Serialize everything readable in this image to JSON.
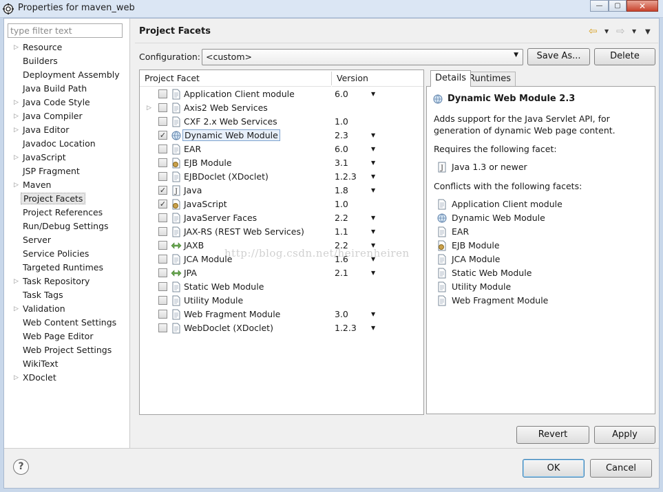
{
  "window": {
    "title": "Properties for maven_web",
    "minimize": "—",
    "maximize": "▢",
    "close": "✕"
  },
  "filter": {
    "placeholder": "type filter text",
    "value": ""
  },
  "nav": {
    "items": [
      {
        "label": "Resource",
        "expandable": true
      },
      {
        "label": "Builders",
        "expandable": false
      },
      {
        "label": "Deployment Assembly",
        "expandable": false
      },
      {
        "label": "Java Build Path",
        "expandable": false
      },
      {
        "label": "Java Code Style",
        "expandable": true
      },
      {
        "label": "Java Compiler",
        "expandable": true
      },
      {
        "label": "Java Editor",
        "expandable": true
      },
      {
        "label": "Javadoc Location",
        "expandable": false
      },
      {
        "label": "JavaScript",
        "expandable": true
      },
      {
        "label": "JSP Fragment",
        "expandable": false
      },
      {
        "label": "Maven",
        "expandable": true
      },
      {
        "label": "Project Facets",
        "expandable": false,
        "selected": true
      },
      {
        "label": "Project References",
        "expandable": false
      },
      {
        "label": "Run/Debug Settings",
        "expandable": false
      },
      {
        "label": "Server",
        "expandable": false
      },
      {
        "label": "Service Policies",
        "expandable": false
      },
      {
        "label": "Targeted Runtimes",
        "expandable": false
      },
      {
        "label": "Task Repository",
        "expandable": true
      },
      {
        "label": "Task Tags",
        "expandable": false
      },
      {
        "label": "Validation",
        "expandable": true
      },
      {
        "label": "Web Content Settings",
        "expandable": false
      },
      {
        "label": "Web Page Editor",
        "expandable": false
      },
      {
        "label": "Web Project Settings",
        "expandable": false
      },
      {
        "label": "WikiText",
        "expandable": false
      },
      {
        "label": "XDoclet",
        "expandable": true
      }
    ]
  },
  "header": {
    "title": "Project Facets"
  },
  "config": {
    "label": "Configuration:",
    "value": "<custom>",
    "save_as": "Save As...",
    "delete": "Delete"
  },
  "table": {
    "col_facet": "Project Facet",
    "col_version": "Version",
    "rows": [
      {
        "name": "Application Client module",
        "version": "6.0",
        "checked": false,
        "dropdown": true,
        "icon": "page"
      },
      {
        "name": "Axis2 Web Services",
        "version": "",
        "checked": false,
        "dropdown": false,
        "icon": "page",
        "expandable": true
      },
      {
        "name": "CXF 2.x Web Services",
        "version": "1.0",
        "checked": false,
        "dropdown": false,
        "icon": "page"
      },
      {
        "name": "Dynamic Web Module",
        "version": "2.3",
        "checked": true,
        "dropdown": true,
        "icon": "globe",
        "selected": true
      },
      {
        "name": "EAR",
        "version": "6.0",
        "checked": false,
        "dropdown": true,
        "icon": "page"
      },
      {
        "name": "EJB Module",
        "version": "3.1",
        "checked": false,
        "dropdown": true,
        "icon": "bean"
      },
      {
        "name": "EJBDoclet (XDoclet)",
        "version": "1.2.3",
        "checked": false,
        "dropdown": true,
        "icon": "page"
      },
      {
        "name": "Java",
        "version": "1.8",
        "checked": true,
        "dropdown": true,
        "icon": "java"
      },
      {
        "name": "JavaScript",
        "version": "1.0",
        "checked": true,
        "dropdown": false,
        "icon": "bean"
      },
      {
        "name": "JavaServer Faces",
        "version": "2.2",
        "checked": false,
        "dropdown": true,
        "icon": "page"
      },
      {
        "name": "JAX-RS (REST Web Services)",
        "version": "1.1",
        "checked": false,
        "dropdown": true,
        "icon": "page"
      },
      {
        "name": "JAXB",
        "version": "2.2",
        "checked": false,
        "dropdown": true,
        "icon": "arrows"
      },
      {
        "name": "JCA Module",
        "version": "1.6",
        "checked": false,
        "dropdown": true,
        "icon": "page"
      },
      {
        "name": "JPA",
        "version": "2.1",
        "checked": false,
        "dropdown": true,
        "icon": "arrows"
      },
      {
        "name": "Static Web Module",
        "version": "",
        "checked": false,
        "dropdown": false,
        "icon": "page"
      },
      {
        "name": "Utility Module",
        "version": "",
        "checked": false,
        "dropdown": false,
        "icon": "page"
      },
      {
        "name": "Web Fragment Module",
        "version": "3.0",
        "checked": false,
        "dropdown": true,
        "icon": "page"
      },
      {
        "name": "WebDoclet (XDoclet)",
        "version": "1.2.3",
        "checked": false,
        "dropdown": true,
        "icon": "page"
      }
    ]
  },
  "details": {
    "tab_details": "Details",
    "tab_runtimes": "Runtimes",
    "title": "Dynamic Web Module 2.3",
    "description_1": "Adds support for the Java Servlet API, for",
    "description_2": "generation of dynamic Web page content.",
    "requires_label": "Requires the following facet:",
    "requires": [
      {
        "name": "Java 1.3 or newer",
        "icon": "java"
      }
    ],
    "conflicts_label": "Conflicts with the following facets:",
    "conflicts": [
      {
        "name": "Application Client module",
        "icon": "page"
      },
      {
        "name": "Dynamic Web Module",
        "icon": "globe"
      },
      {
        "name": "EAR",
        "icon": "page"
      },
      {
        "name": "EJB Module",
        "icon": "bean"
      },
      {
        "name": "JCA Module",
        "icon": "page"
      },
      {
        "name": "Static Web Module",
        "icon": "page"
      },
      {
        "name": "Utility Module",
        "icon": "page"
      },
      {
        "name": "Web Fragment Module",
        "icon": "page"
      }
    ]
  },
  "buttons": {
    "revert": "Revert",
    "apply": "Apply",
    "ok": "OK",
    "cancel": "Cancel",
    "help": "?"
  },
  "watermark": "http://blog.csdn.net/heirenheiren",
  "colors": {
    "selection_border": "#7da2ce",
    "window_chrome": "#dbe6f4"
  }
}
